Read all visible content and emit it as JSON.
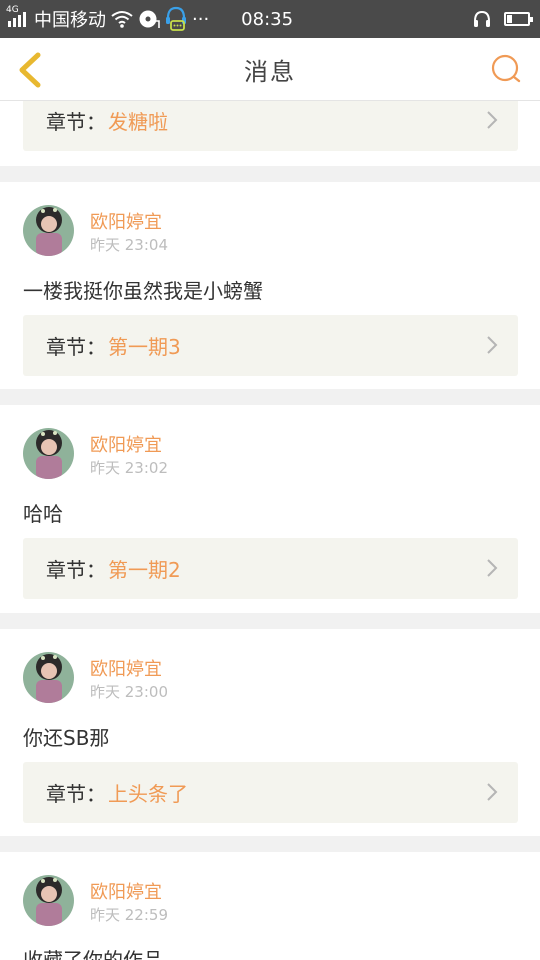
{
  "status_bar": {
    "network": "4G",
    "carrier": "中国移动",
    "extra": "···",
    "time": "08:35",
    "icons": [
      "signal-icon",
      "wifi-icon",
      "music-icon",
      "notification-icon",
      "headset-icon",
      "battery-icon"
    ]
  },
  "nav": {
    "title": "消息",
    "back_icon": "chevron-left-icon",
    "search_icon": "search-icon"
  },
  "colors": {
    "accent": "#f09a55",
    "back_arrow": "#e8b830",
    "chapter_bg": "#f4f4ee",
    "page_bg": "#f1f1f1",
    "muted": "#bdbdbd"
  },
  "chapter_label": "章节：",
  "partial_top": {
    "chapter_title": "发糖啦"
  },
  "messages": [
    {
      "user_name": "欧阳婷宜",
      "time": "昨天 23:04",
      "comment": "一楼我挺你虽然我是小螃蟹",
      "chapter_title": "第一期3"
    },
    {
      "user_name": "欧阳婷宜",
      "time": "昨天 23:02",
      "comment": "哈哈",
      "chapter_title": "第一期2"
    },
    {
      "user_name": "欧阳婷宜",
      "time": "昨天 23:00",
      "comment": "你还SB那",
      "chapter_title": "上头条了"
    },
    {
      "user_name": "欧阳婷宜",
      "time": "昨天 22:59",
      "comment": "收藏了你的作品"
    }
  ]
}
